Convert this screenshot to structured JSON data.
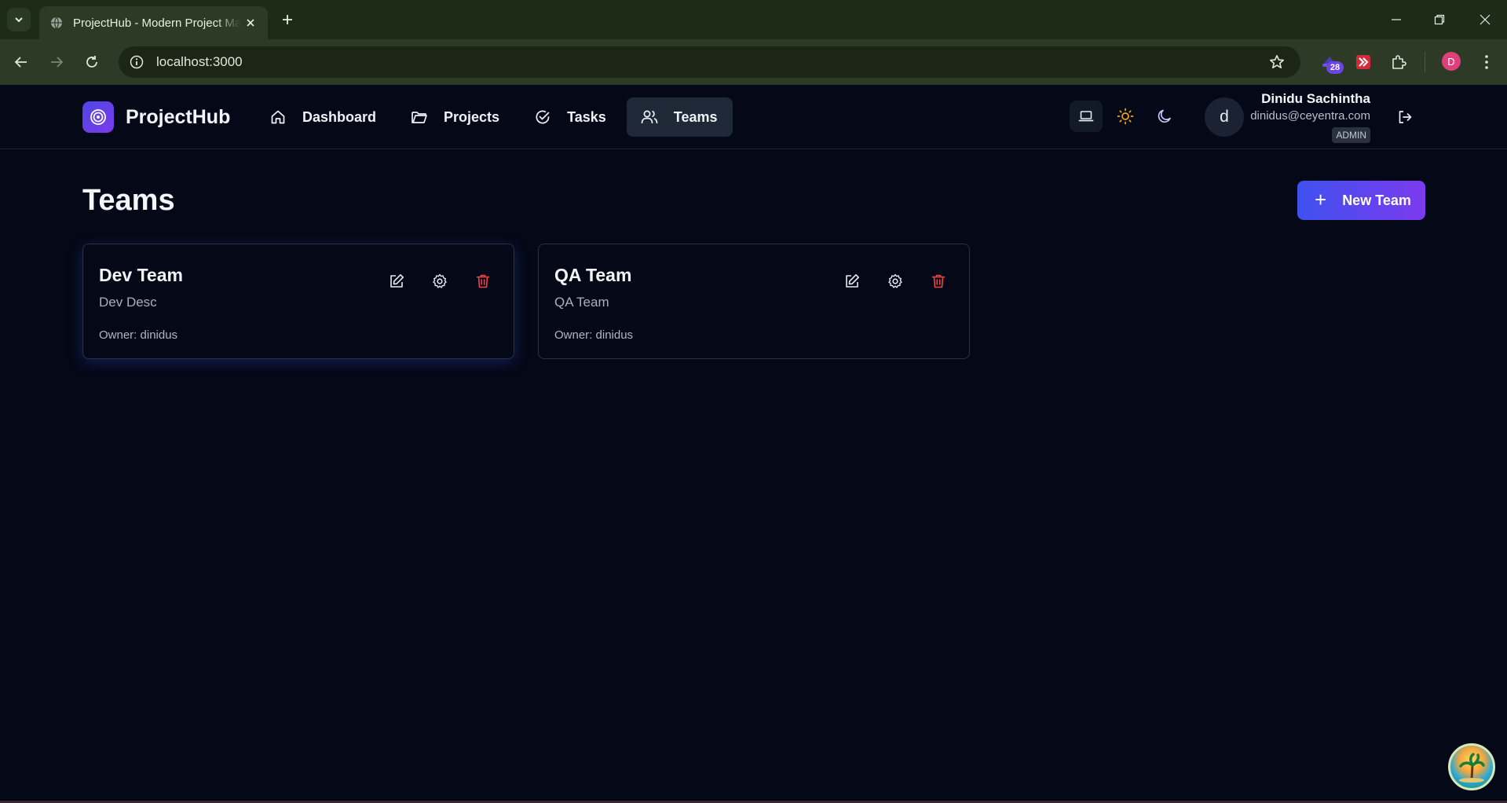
{
  "browser": {
    "tab_title": "ProjectHub - Modern Project Management",
    "url": "localhost:3000",
    "extension_badge_count": "28",
    "profile_initial": "D"
  },
  "header": {
    "brand_name": "ProjectHub",
    "nav": [
      {
        "label": "Dashboard",
        "icon": "home-icon",
        "active": false
      },
      {
        "label": "Projects",
        "icon": "folder-icon",
        "active": false
      },
      {
        "label": "Tasks",
        "icon": "check-circle-icon",
        "active": false
      },
      {
        "label": "Teams",
        "icon": "users-icon",
        "active": true
      }
    ],
    "theme_options": [
      "laptop-icon",
      "sun-icon",
      "moon-icon"
    ],
    "user": {
      "initial": "d",
      "name": "Dinidu Sachintha",
      "email": "dinidus@ceyentra.com",
      "role": "ADMIN"
    }
  },
  "page": {
    "title": "Teams",
    "new_button_label": "New Team"
  },
  "teams": [
    {
      "name": "Dev Team",
      "description": "Dev Desc",
      "owner": "Owner: dinidus"
    },
    {
      "name": "QA Team",
      "description": "QA Team",
      "owner": "Owner: dinidus"
    }
  ],
  "colors": {
    "background": "#050816",
    "accent_start": "#3f51f0",
    "accent_end": "#7c3aed",
    "danger": "#ef4444",
    "sun": "#f5a524"
  }
}
